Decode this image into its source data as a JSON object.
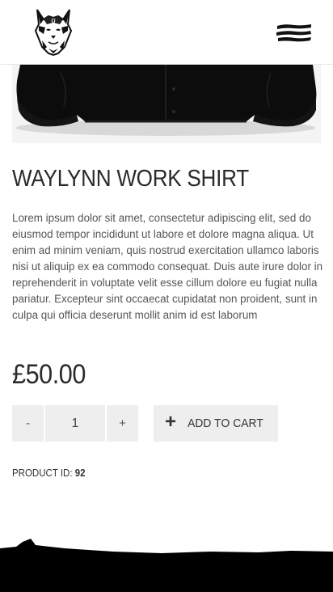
{
  "header": {
    "logo_icon": "wolf-logo",
    "menu_icon": "hamburger-menu-icon"
  },
  "product": {
    "title": "WAYLYNN WORK SHIRT",
    "description": "Lorem ipsum dolor sit amet, consectetur adipiscing elit, sed do eiusmod tempor incididunt ut labore et dolore magna aliqua. Ut enim ad minim veniam, quis nostrud exercitation ullamco laboris nisi ut aliquip ex ea commodo consequat. Duis aute irure dolor in reprehenderit in voluptate velit esse cillum dolore eu fugiat nulla pariatur. Excepteur sint occaecat cupidatat non proident, sunt in culpa qui officia deserunt mollit anim id est laborum",
    "price": "£50.00",
    "image_icon": "black-shirt-photo"
  },
  "quantity": {
    "decrement_label": "-",
    "value": "1",
    "increment_label": "+"
  },
  "cart": {
    "plus_icon": "+",
    "add_label": "ADD TO CART"
  },
  "meta": {
    "product_id_label": "PRODUCT ID:",
    "product_id_value": "92"
  },
  "colors": {
    "background": "#ffffff",
    "button_bg": "#eeeeee",
    "text": "#333333",
    "footer": "#000000"
  }
}
